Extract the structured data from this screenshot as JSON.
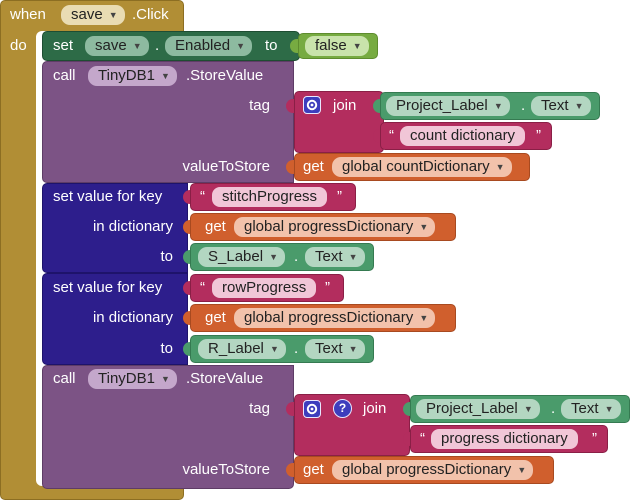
{
  "event": {
    "when": "when",
    "component": "save",
    "event": ".Click",
    "do": "do"
  },
  "set_enabled": {
    "set": "set",
    "component": "save",
    "property": "Enabled",
    "to": "to",
    "value": "false"
  },
  "store1": {
    "call": "call",
    "component": "TinyDB1",
    "method": ".StoreValue",
    "tag": "tag",
    "join": "join",
    "label_comp": "Project_Label",
    "label_prop": "Text",
    "string": "count dictionary",
    "value_to_store": "valueToStore",
    "get": "get",
    "variable": "global countDictionary"
  },
  "set_key1": {
    "set_value_for_key": "set value for key",
    "key": "stitchProgress",
    "in_dictionary": "in dictionary",
    "get": "get",
    "variable": "global progressDictionary",
    "to": "to",
    "comp": "S_Label",
    "prop": "Text"
  },
  "set_key2": {
    "set_value_for_key": "set value for key",
    "key": "rowProgress",
    "in_dictionary": "in dictionary",
    "get": "get",
    "variable": "global progressDictionary",
    "to": "to",
    "comp": "R_Label",
    "prop": "Text"
  },
  "store2": {
    "call": "call",
    "component": "TinyDB1",
    "method": ".StoreValue",
    "tag": "tag",
    "join": "join",
    "help": "?",
    "label_comp": "Project_Label",
    "label_prop": "Text",
    "string": "progress dictionary",
    "value_to_store": "valueToStore",
    "get": "get",
    "variable": "global progressDictionary"
  },
  "quote": "“",
  "quote_close": "”",
  "dot": ".",
  "colors": {
    "event": "#b18e35",
    "set_component": "#2d6b47",
    "component_green": "#4a9b6b",
    "logic_green": "#77ab41",
    "procedure_purple": "#7c5385",
    "dict_blue": "#2d1e8c",
    "text_string": "#b32d5e",
    "variable_orange": "#d05f2d",
    "pill_light": "#f1c6d7"
  }
}
